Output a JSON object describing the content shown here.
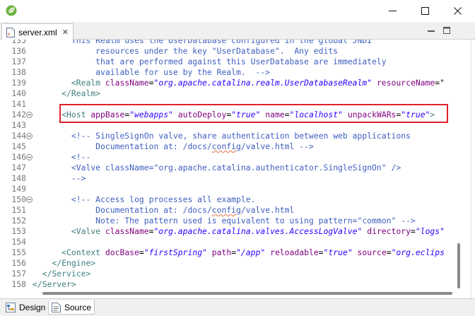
{
  "window": {
    "app_icon": "spring-leaf-icon",
    "minimize_icon": "minimize-icon",
    "maximize_icon": "maximize-icon",
    "close_icon": "close-icon"
  },
  "editor_tab": {
    "label": "server.xml",
    "file_icon": "xml-file-icon",
    "close_glyph": "✕"
  },
  "view_controls": {
    "minimize_icon": "view-minimize-icon",
    "maximize_icon": "view-maximize-icon"
  },
  "highlight_color": "#e0202a",
  "lines": [
    {
      "n": "135",
      "fold": "",
      "segs": [
        {
          "t": "txt",
          "v": "        "
        },
        {
          "t": "cmt",
          "v": "This Realm uses the UserDatabase configured in the global JNDI"
        }
      ]
    },
    {
      "n": "136",
      "fold": "",
      "segs": [
        {
          "t": "cmt",
          "v": "             resources under the key \"UserDatabase\".  Any edits"
        }
      ]
    },
    {
      "n": "137",
      "fold": "",
      "segs": [
        {
          "t": "cmt",
          "v": "             that are performed against this UserDatabase are immediately"
        }
      ]
    },
    {
      "n": "138",
      "fold": "",
      "segs": [
        {
          "t": "cmt",
          "v": "             available for use by the Realm.  -->"
        }
      ]
    },
    {
      "n": "139",
      "fold": "",
      "segs": [
        {
          "t": "txt",
          "v": "        "
        },
        {
          "t": "tag",
          "v": "<Realm "
        },
        {
          "t": "attr",
          "v": "className"
        },
        {
          "t": "txt",
          "v": "="
        },
        {
          "t": "val",
          "v": "\"org.apache.catalina.realm.UserDatabaseRealm\""
        },
        {
          "t": "txt",
          "v": " "
        },
        {
          "t": "attr",
          "v": "resourceName"
        },
        {
          "t": "txt",
          "v": "=\""
        }
      ]
    },
    {
      "n": "140",
      "fold": "",
      "segs": [
        {
          "t": "txt",
          "v": "      "
        },
        {
          "t": "tag",
          "v": "</Realm>"
        }
      ]
    },
    {
      "n": "141",
      "fold": "",
      "segs": []
    },
    {
      "n": "142",
      "fold": "collapse",
      "segs": [
        {
          "t": "txt",
          "v": "      "
        },
        {
          "t": "tag",
          "v": "<Host "
        },
        {
          "t": "attr",
          "v": "appBase"
        },
        {
          "t": "txt",
          "v": "="
        },
        {
          "t": "val",
          "v": "\"webapps\""
        },
        {
          "t": "txt",
          "v": " "
        },
        {
          "t": "attr",
          "v": "autoDeploy"
        },
        {
          "t": "txt",
          "v": "="
        },
        {
          "t": "val",
          "v": "\"true\""
        },
        {
          "t": "txt",
          "v": " "
        },
        {
          "t": "attr",
          "v": "name"
        },
        {
          "t": "txt",
          "v": "="
        },
        {
          "t": "val",
          "v": "\"localhost\""
        },
        {
          "t": "txt",
          "v": " "
        },
        {
          "t": "attr",
          "v": "unpackWARs"
        },
        {
          "t": "txt",
          "v": "="
        },
        {
          "t": "val",
          "v": "\"true\""
        },
        {
          "t": "tag",
          "v": ">"
        }
      ]
    },
    {
      "n": "143",
      "fold": "",
      "segs": []
    },
    {
      "n": "144",
      "fold": "collapse",
      "segs": [
        {
          "t": "txt",
          "v": "        "
        },
        {
          "t": "cmt",
          "v": "<!-- SingleSignOn valve, share authentication between web applications"
        }
      ]
    },
    {
      "n": "145",
      "fold": "",
      "segs": [
        {
          "t": "cmt",
          "v": "             Documentation at: /docs/"
        },
        {
          "t": "cmterr",
          "v": "config"
        },
        {
          "t": "cmt",
          "v": "/valve.html -->"
        }
      ]
    },
    {
      "n": "146",
      "fold": "collapse",
      "segs": [
        {
          "t": "txt",
          "v": "        "
        },
        {
          "t": "cmt",
          "v": "<!--"
        }
      ]
    },
    {
      "n": "147",
      "fold": "",
      "segs": [
        {
          "t": "txt",
          "v": "        "
        },
        {
          "t": "cmt",
          "v": "<Valve className=\"org.apache.catalina.authenticator.SingleSignOn\" />"
        }
      ]
    },
    {
      "n": "148",
      "fold": "",
      "segs": [
        {
          "t": "txt",
          "v": "        "
        },
        {
          "t": "cmt",
          "v": "-->"
        }
      ]
    },
    {
      "n": "149",
      "fold": "",
      "segs": []
    },
    {
      "n": "150",
      "fold": "collapse",
      "segs": [
        {
          "t": "txt",
          "v": "        "
        },
        {
          "t": "cmt",
          "v": "<!-- Access log processes all example."
        }
      ]
    },
    {
      "n": "151",
      "fold": "",
      "segs": [
        {
          "t": "cmt",
          "v": "             Documentation at: /docs/"
        },
        {
          "t": "cmterr",
          "v": "config"
        },
        {
          "t": "cmt",
          "v": "/valve.html"
        }
      ]
    },
    {
      "n": "152",
      "fold": "",
      "segs": [
        {
          "t": "cmt",
          "v": "             Note: The pattern used is equivalent to using pattern=\"common\" -->"
        }
      ]
    },
    {
      "n": "153",
      "fold": "",
      "segs": [
        {
          "t": "txt",
          "v": "        "
        },
        {
          "t": "tag",
          "v": "<Valve "
        },
        {
          "t": "attr",
          "v": "className"
        },
        {
          "t": "txt",
          "v": "="
        },
        {
          "t": "val",
          "v": "\"org.apache.catalina.valves.AccessLogValve\""
        },
        {
          "t": "txt",
          "v": " "
        },
        {
          "t": "attr",
          "v": "directory"
        },
        {
          "t": "txt",
          "v": "="
        },
        {
          "t": "val",
          "v": "\"logs\""
        }
      ]
    },
    {
      "n": "154",
      "fold": "",
      "segs": []
    },
    {
      "n": "155",
      "fold": "",
      "segs": [
        {
          "t": "txt",
          "v": "      "
        },
        {
          "t": "tag",
          "v": "<Context "
        },
        {
          "t": "attr",
          "v": "docBase"
        },
        {
          "t": "txt",
          "v": "="
        },
        {
          "t": "val",
          "v": "\"firstSpring\""
        },
        {
          "t": "txt",
          "v": " "
        },
        {
          "t": "attr",
          "v": "path"
        },
        {
          "t": "txt",
          "v": "="
        },
        {
          "t": "val",
          "v": "\"/app\""
        },
        {
          "t": "txt",
          "v": " "
        },
        {
          "t": "attr",
          "v": "reloadable"
        },
        {
          "t": "txt",
          "v": "="
        },
        {
          "t": "val",
          "v": "\"true\""
        },
        {
          "t": "txt",
          "v": " "
        },
        {
          "t": "attr",
          "v": "source"
        },
        {
          "t": "txt",
          "v": "="
        },
        {
          "t": "val",
          "v": "\"org.eclips"
        }
      ]
    },
    {
      "n": "156",
      "fold": "",
      "segs": [
        {
          "t": "txt",
          "v": "    "
        },
        {
          "t": "tag",
          "v": "</Engine>"
        }
      ]
    },
    {
      "n": "157",
      "fold": "",
      "segs": [
        {
          "t": "txt",
          "v": "  "
        },
        {
          "t": "tag",
          "v": "</Service>"
        }
      ]
    },
    {
      "n": "158",
      "fold": "",
      "segs": [
        {
          "t": "tag",
          "v": "</Server>"
        }
      ]
    }
  ],
  "bottom_tabs": [
    {
      "label": "Design",
      "icon": "design-view-icon"
    },
    {
      "label": "Source",
      "icon": "source-view-icon"
    }
  ]
}
